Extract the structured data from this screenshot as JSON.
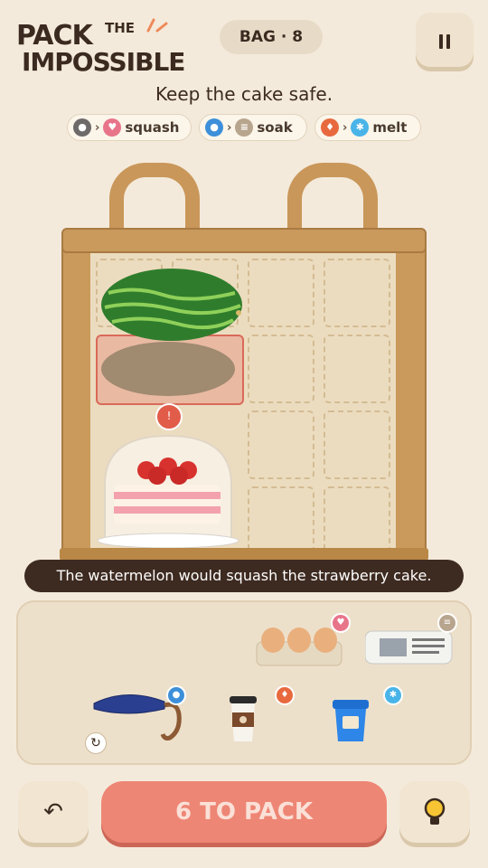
{
  "logo": {
    "line1": "PACK",
    "the": "THE",
    "line2": "IMPOSSIBLE"
  },
  "header": {
    "bag_label": "BAG · 8",
    "pause_icon": "pause-icon"
  },
  "goal": "Keep the cake safe.",
  "rules": [
    {
      "from_icon": "weight-icon",
      "to_icon": "fragile-glass-icon",
      "verb": "squash",
      "from_color": "#6e6a6a",
      "to_color": "#e8748a"
    },
    {
      "from_icon": "water-drop-icon",
      "to_icon": "paper-icon",
      "verb": "soak",
      "from_color": "#3d8fd9",
      "to_color": "#b8a58e"
    },
    {
      "from_icon": "flame-icon",
      "to_icon": "snowflake-icon",
      "verb": "melt",
      "from_color": "#e8693e",
      "to_color": "#49b4e8"
    }
  ],
  "board": {
    "held_item": "watermelon",
    "placed_items": [
      "strawberry cake"
    ],
    "warning_icon": "squash-warning-icon",
    "tooltip": "The watermelon would squash the strawberry cake."
  },
  "tray": {
    "items": [
      {
        "name": "eggs",
        "badge": "fragile-glass-icon",
        "badge_color": "#e8748a"
      },
      {
        "name": "newspaper",
        "badge": "paper-icon",
        "badge_color": "#b8a58e"
      },
      {
        "name": "umbrella",
        "badge": "water-drop-icon",
        "badge_color": "#3d8fd9",
        "rotatable": true
      },
      {
        "name": "coffee cup",
        "badge": "flame-icon",
        "badge_color": "#e8693e"
      },
      {
        "name": "ice cream tub",
        "badge": "snowflake-icon",
        "badge_color": "#49b4e8"
      }
    ]
  },
  "footer": {
    "pack_label": "6 TO PACK",
    "undo_icon": "undo-icon",
    "hint_icon": "lightbulb-icon"
  },
  "colors": {
    "background": "#f4eadb",
    "pack_button": "#ee8675",
    "bag": "#c99a5c",
    "tooltip": "#3d2a20"
  }
}
